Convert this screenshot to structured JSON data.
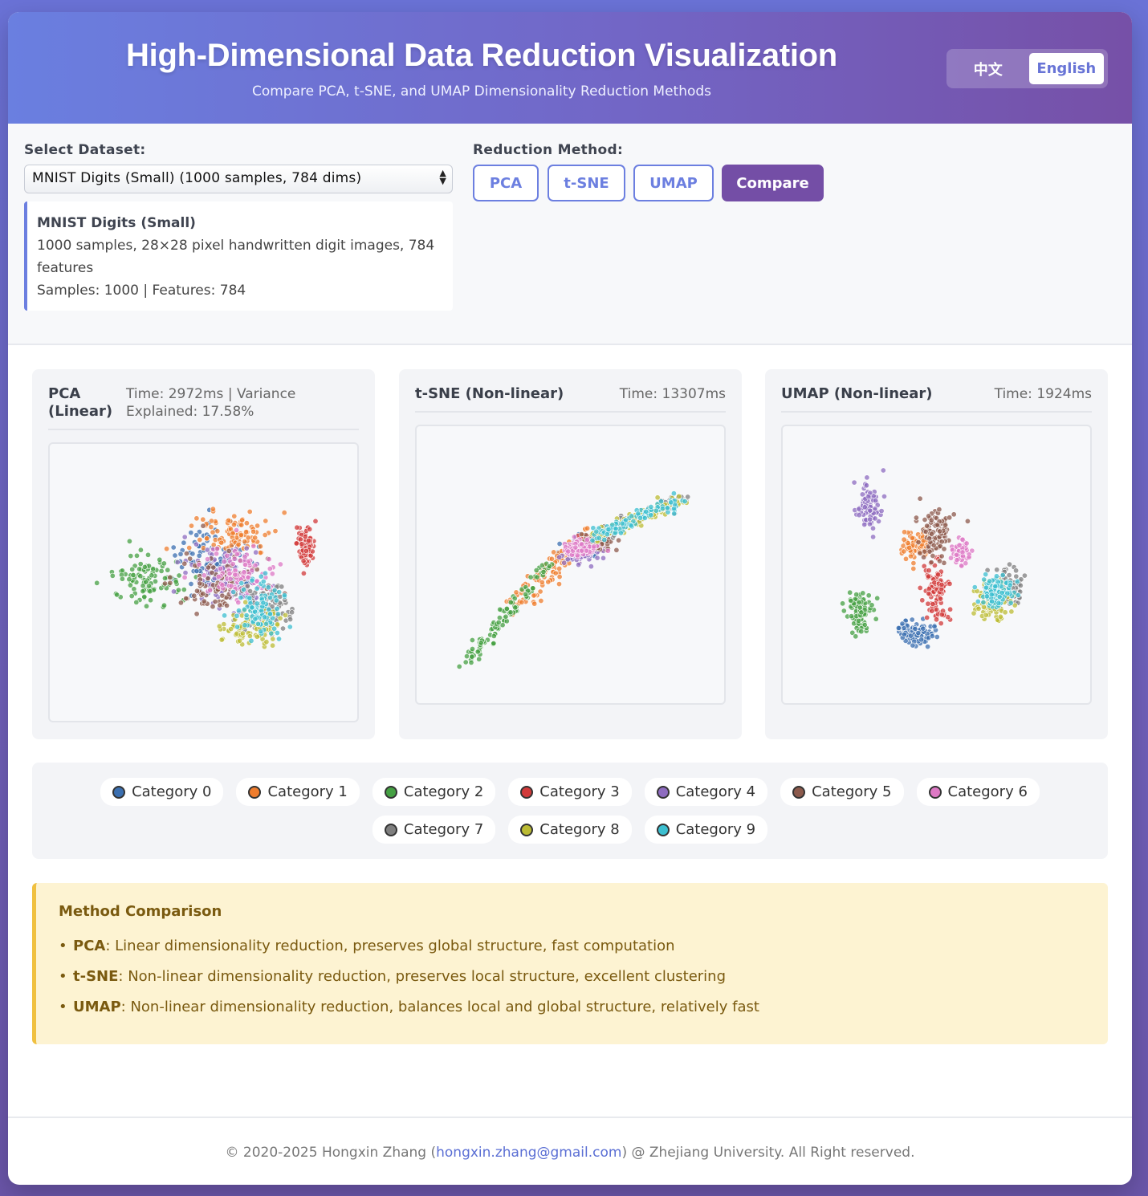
{
  "header": {
    "title": "High-Dimensional Data Reduction Visualization",
    "subtitle": "Compare PCA, t-SNE, and UMAP Dimensionality Reduction Methods",
    "lang_zh": "中文",
    "lang_en": "English"
  },
  "controls": {
    "dataset_label": "Select Dataset:",
    "dataset_value": "MNIST Digits (Small) (1000 samples, 784 dims)",
    "dataset_info": {
      "name": "MNIST Digits (Small)",
      "desc": "1000 samples, 28×28 pixel handwritten digit images, 784 features",
      "stats": "Samples: 1000 | Features: 784"
    },
    "method_label": "Reduction Method:",
    "methods": [
      "PCA",
      "t-SNE",
      "UMAP",
      "Compare"
    ],
    "active_method": "Compare"
  },
  "panels": [
    {
      "title_line1": "PCA",
      "title_line2": "(Linear)",
      "meta_line1": "Time: 2972ms | Variance",
      "meta_line2": "Explained: 17.58%"
    },
    {
      "title": "t-SNE (Non-linear)",
      "meta": "Time: 13307ms"
    },
    {
      "title": "UMAP (Non-linear)",
      "meta": "Time: 1924ms"
    }
  ],
  "legend": [
    {
      "label": "Category 0",
      "color": "#3b6fb0"
    },
    {
      "label": "Category 1",
      "color": "#ef7d2e"
    },
    {
      "label": "Category 2",
      "color": "#45a043"
    },
    {
      "label": "Category 3",
      "color": "#d23a3a"
    },
    {
      "label": "Category 4",
      "color": "#8e6cc0"
    },
    {
      "label": "Category 5",
      "color": "#8c5a4c"
    },
    {
      "label": "Category 6",
      "color": "#de79c5"
    },
    {
      "label": "Category 7",
      "color": "#7f7f7f"
    },
    {
      "label": "Category 8",
      "color": "#bcbc34"
    },
    {
      "label": "Category 9",
      "color": "#3cbfd0"
    }
  ],
  "comparison": {
    "title": "Method Comparison",
    "items": [
      {
        "name": "PCA",
        "text": ": Linear dimensionality reduction, preserves global structure, fast computation"
      },
      {
        "name": "t-SNE",
        "text": ": Non-linear dimensionality reduction, preserves local structure, excellent clustering"
      },
      {
        "name": "UMAP",
        "text": ": Non-linear dimensionality reduction, balances local and global structure, relatively fast"
      }
    ]
  },
  "footer": {
    "prefix": "© 2020-2025 Hongxin Zhang (",
    "email": "hongxin.zhang@gmail.com",
    "suffix": ") @ Zhejiang University. All Right reserved."
  },
  "chart_data": [
    {
      "type": "scatter",
      "method": "PCA",
      "n_points": 1000,
      "series": [
        {
          "name": "Category 0",
          "center": [
            0.55,
            0.38
          ],
          "spread": [
            0.14,
            0.14
          ]
        },
        {
          "name": "Category 1",
          "center": [
            0.62,
            0.28
          ],
          "spread": [
            0.13,
            0.09
          ]
        },
        {
          "name": "Category 2",
          "center": [
            0.27,
            0.49
          ],
          "spread": [
            0.12,
            0.09
          ]
        },
        {
          "name": "Category 3",
          "center": [
            0.92,
            0.32
          ],
          "spread": [
            0.03,
            0.07
          ]
        },
        {
          "name": "Category 4",
          "center": [
            0.6,
            0.47
          ],
          "spread": [
            0.13,
            0.12
          ]
        },
        {
          "name": "Category 5",
          "center": [
            0.55,
            0.5
          ],
          "spread": [
            0.15,
            0.11
          ]
        },
        {
          "name": "Category 6",
          "center": [
            0.65,
            0.46
          ],
          "spread": [
            0.13,
            0.12
          ]
        },
        {
          "name": "Category 7",
          "center": [
            0.75,
            0.62
          ],
          "spread": [
            0.08,
            0.09
          ]
        },
        {
          "name": "Category 8",
          "center": [
            0.7,
            0.7
          ],
          "spread": [
            0.1,
            0.08
          ]
        },
        {
          "name": "Category 9",
          "center": [
            0.73,
            0.63
          ],
          "spread": [
            0.08,
            0.11
          ]
        }
      ]
    },
    {
      "type": "scatter",
      "method": "t-SNE",
      "n_points": 1000,
      "series": [
        {
          "name": "Category 0",
          "center": [
            0.55,
            0.42
          ],
          "spread": [
            0.05,
            0.04
          ]
        },
        {
          "name": "Category 1",
          "center": [
            0.44,
            0.52
          ],
          "spread": [
            0.07,
            0.07
          ]
        },
        {
          "name": "Category 2",
          "center": [
            0.25,
            0.7
          ],
          "spread": [
            0.08,
            0.1
          ]
        },
        {
          "name": "Category 3",
          "center": [
            0.58,
            0.4
          ],
          "spread": [
            0.05,
            0.03
          ]
        },
        {
          "name": "Category 4",
          "center": [
            0.55,
            0.44
          ],
          "spread": [
            0.06,
            0.04
          ]
        },
        {
          "name": "Category 5",
          "center": [
            0.6,
            0.4
          ],
          "spread": [
            0.06,
            0.03
          ]
        },
        {
          "name": "Category 6",
          "center": [
            0.54,
            0.42
          ],
          "spread": [
            0.05,
            0.03
          ]
        },
        {
          "name": "Category 7",
          "center": [
            0.82,
            0.26
          ],
          "spread": [
            0.06,
            0.03
          ]
        },
        {
          "name": "Category 8",
          "center": [
            0.7,
            0.3
          ],
          "spread": [
            0.08,
            0.03
          ]
        },
        {
          "name": "Category 9",
          "center": [
            0.75,
            0.28
          ],
          "spread": [
            0.06,
            0.03
          ]
        }
      ]
    },
    {
      "type": "scatter",
      "method": "UMAP",
      "n_points": 1000,
      "series": [
        {
          "name": "Category 0",
          "center": [
            0.43,
            0.82
          ],
          "spread": [
            0.07,
            0.04
          ]
        },
        {
          "name": "Category 1",
          "center": [
            0.42,
            0.4
          ],
          "spread": [
            0.06,
            0.06
          ]
        },
        {
          "name": "Category 2",
          "center": [
            0.18,
            0.73
          ],
          "spread": [
            0.04,
            0.07
          ]
        },
        {
          "name": "Category 3",
          "center": [
            0.5,
            0.62
          ],
          "spread": [
            0.04,
            0.11
          ]
        },
        {
          "name": "Category 4",
          "center": [
            0.22,
            0.22
          ],
          "spread": [
            0.04,
            0.09
          ]
        },
        {
          "name": "Category 5",
          "center": [
            0.5,
            0.35
          ],
          "spread": [
            0.05,
            0.1
          ]
        },
        {
          "name": "Category 6",
          "center": [
            0.6,
            0.44
          ],
          "spread": [
            0.03,
            0.04
          ]
        },
        {
          "name": "Category 7",
          "center": [
            0.78,
            0.6
          ],
          "spread": [
            0.06,
            0.07
          ]
        },
        {
          "name": "Category 8",
          "center": [
            0.73,
            0.67
          ],
          "spread": [
            0.06,
            0.07
          ]
        },
        {
          "name": "Category 9",
          "center": [
            0.75,
            0.63
          ],
          "spread": [
            0.06,
            0.06
          ]
        }
      ]
    }
  ]
}
